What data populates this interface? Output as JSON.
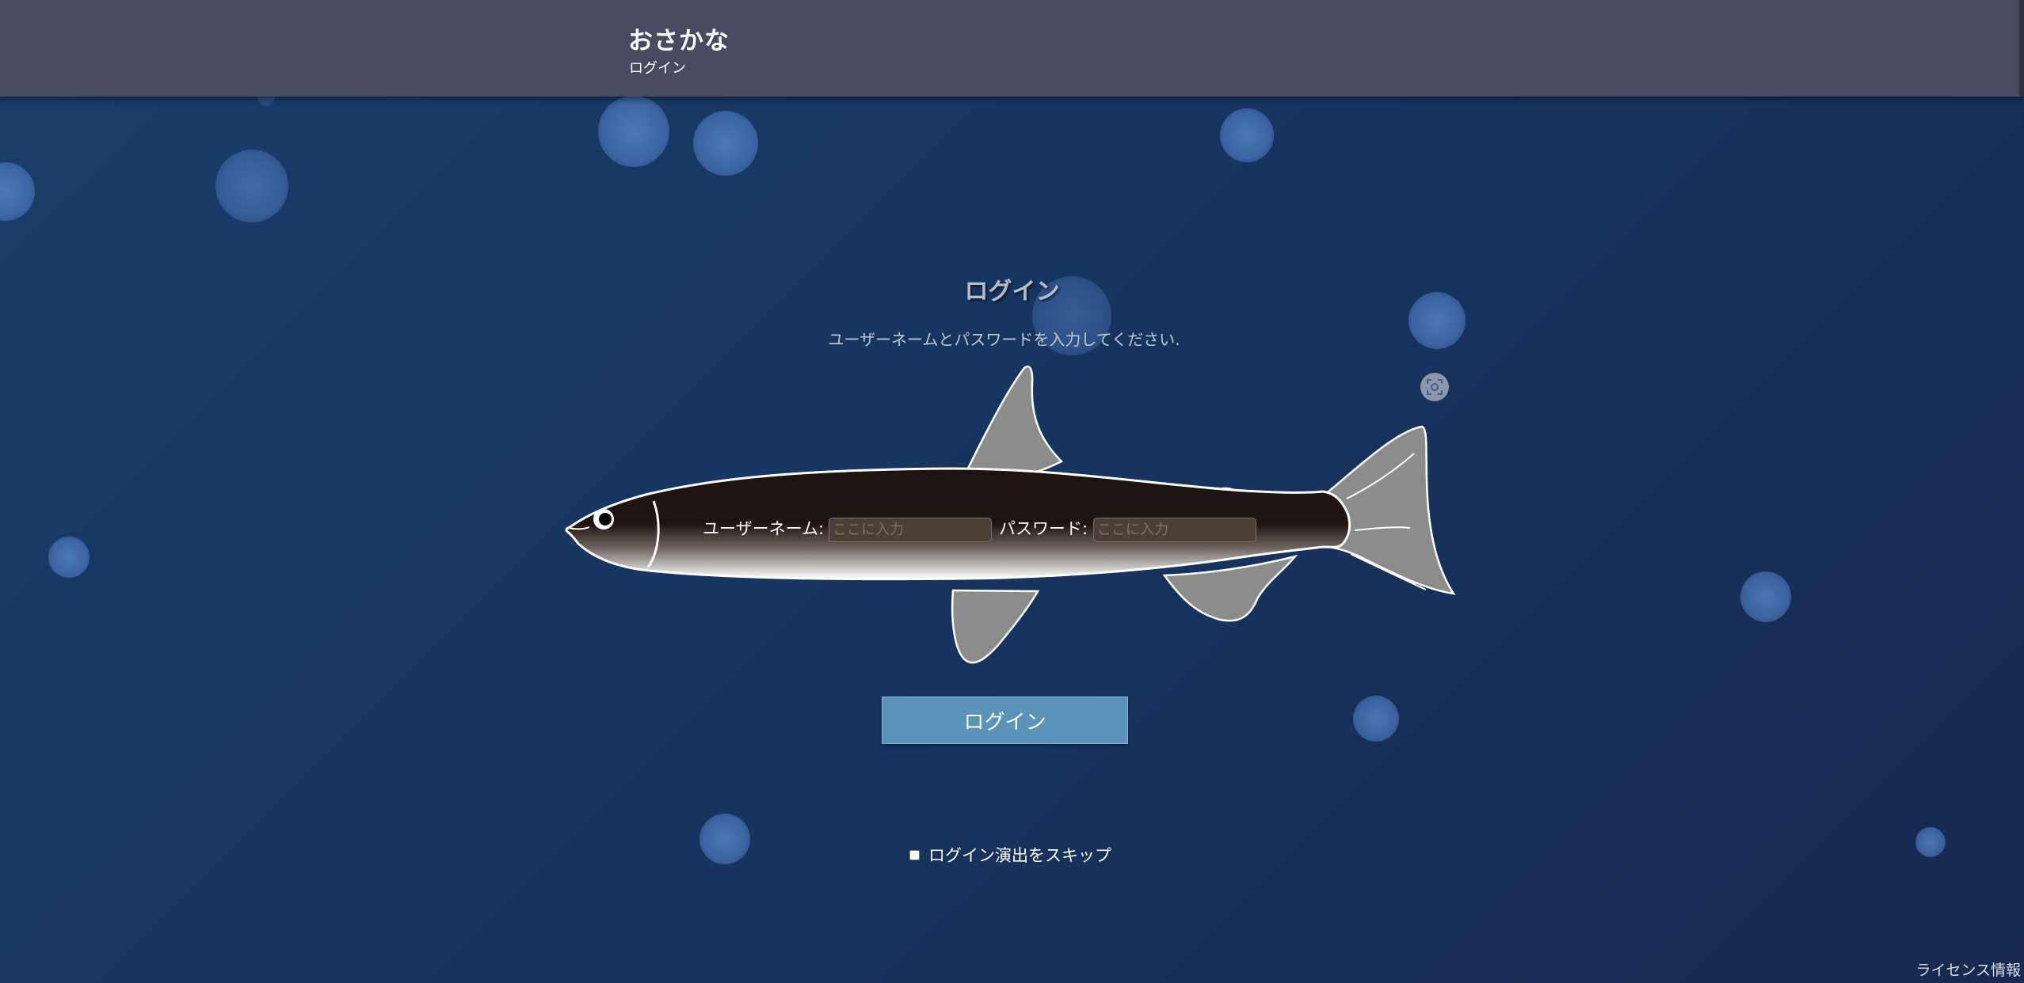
{
  "header": {
    "app_title": "おさかな",
    "page_subtitle": "ログイン"
  },
  "login": {
    "heading": "ログイン",
    "instruction": "ユーザーネームとパスワードを入力してください.",
    "username_label": "ユーザーネーム:",
    "username_placeholder": "ここに入力",
    "username_value": "",
    "password_label": "パスワード:",
    "password_placeholder": "ここに入力",
    "password_value": "",
    "submit_label": "ログイン",
    "skip_label": "ログイン演出をスキップ",
    "skip_checked": false
  },
  "footer": {
    "license_label": "ライセンス情報"
  },
  "icons": {
    "scan": "scan-icon",
    "fish": "fish-illustration"
  },
  "colors": {
    "header_bg": "#474a60",
    "background": "#173561",
    "button_bg": "#5a93b9",
    "fish_body": "#1f1714",
    "fish_fin": "#8c8c8c",
    "bubble": "#4f7cbf"
  }
}
